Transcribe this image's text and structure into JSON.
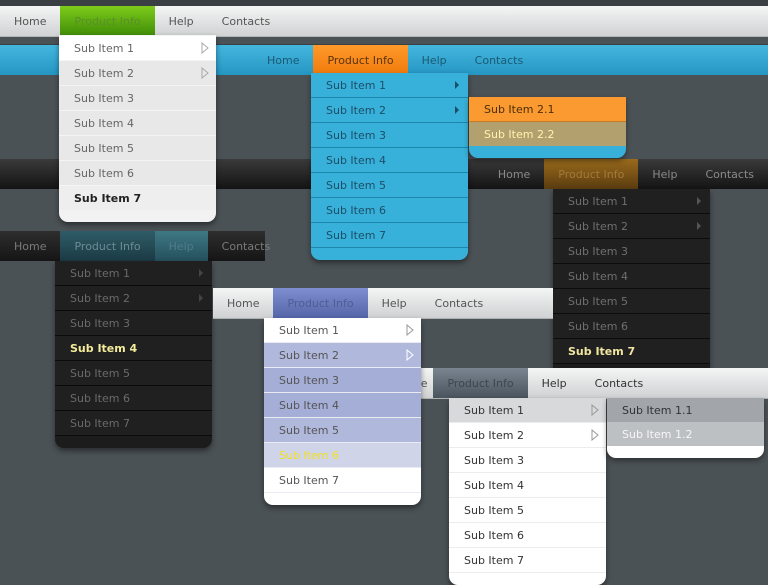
{
  "menus": {
    "green": {
      "nav": [
        "Home",
        "Product Info",
        "Help",
        "Contacts"
      ],
      "items": [
        "Sub Item 1",
        "Sub Item 2",
        "Sub Item 3",
        "Sub Item 4",
        "Sub Item 5",
        "Sub Item 6",
        "Sub Item 7"
      ],
      "accent": "#5aa812"
    },
    "blue": {
      "nav": [
        "Home",
        "Product Info",
        "Help",
        "Contacts"
      ],
      "items": [
        "Sub Item 1",
        "Sub Item 2",
        "Sub Item 3",
        "Sub Item 4",
        "Sub Item 5",
        "Sub Item 6",
        "Sub Item 7"
      ],
      "submenu": [
        "Sub Item 2.1",
        "Sub Item 2.2"
      ],
      "accent": "#f7891c"
    },
    "dark_bronze": {
      "nav": [
        "Home",
        "Product Info",
        "Help",
        "Contacts"
      ],
      "items": [
        "Sub Item 1",
        "Sub Item 2",
        "Sub Item 3",
        "Sub Item 4",
        "Sub Item 5",
        "Sub Item 6",
        "Sub Item 7"
      ],
      "accent": "#8a5e1a"
    },
    "dark_teal": {
      "nav": [
        "Home",
        "Product Info",
        "Help",
        "Contacts"
      ],
      "items": [
        "Sub Item 1",
        "Sub Item 2",
        "Sub Item 3",
        "Sub Item 4",
        "Sub Item 5",
        "Sub Item 6",
        "Sub Item 7"
      ],
      "accent": "#2f5c68"
    },
    "lavender": {
      "nav": [
        "Home",
        "Product Info",
        "Help",
        "Contacts"
      ],
      "items": [
        "Sub Item 1",
        "Sub Item 2",
        "Sub Item 3",
        "Sub Item 4",
        "Sub Item 5",
        "Sub Item 6",
        "Sub Item 7"
      ],
      "accent": "#6676bc"
    },
    "slate": {
      "nav": [
        "me",
        "Product Info",
        "Help",
        "Contacts"
      ],
      "items": [
        "Sub Item 1",
        "Sub Item 2",
        "Sub Item 3",
        "Sub Item 4",
        "Sub Item 5",
        "Sub Item 6",
        "Sub Item 7"
      ],
      "submenu": [
        "Sub Item 1.1",
        "Sub Item 1.2"
      ],
      "accent": "#5e6872"
    }
  },
  "icons": {
    "submenu_arrow": "chevron-right-icon"
  }
}
